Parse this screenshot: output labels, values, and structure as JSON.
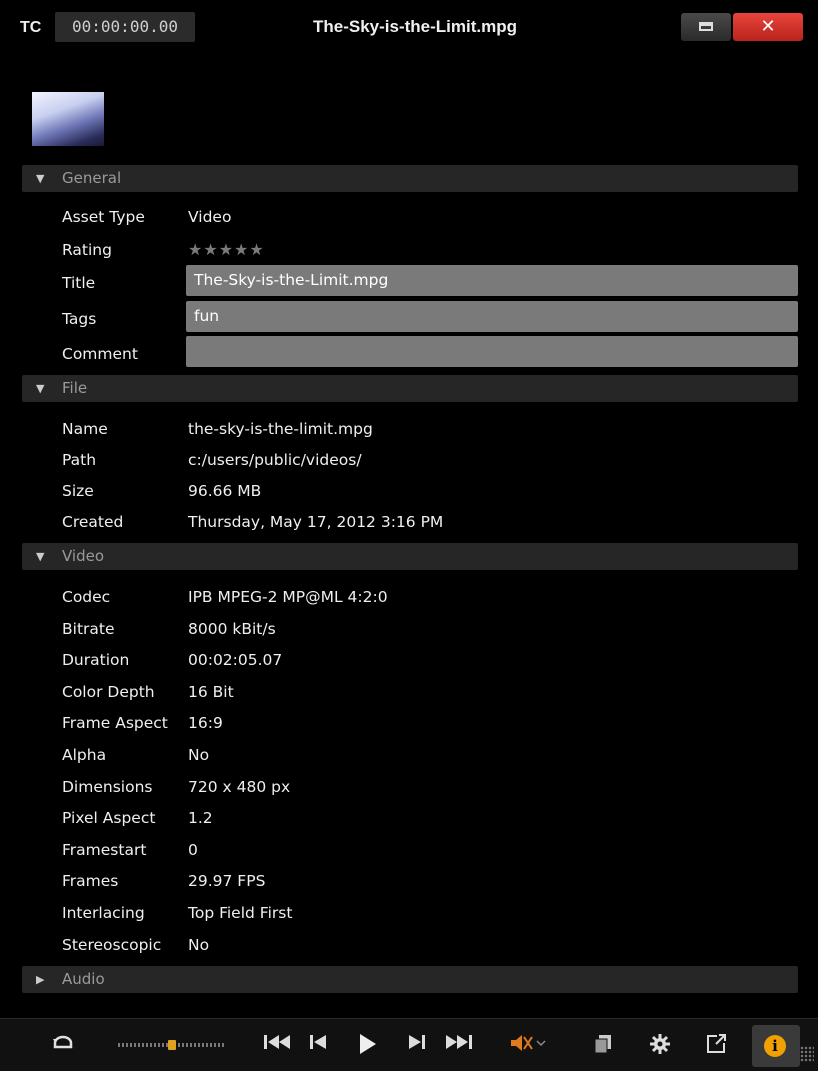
{
  "titlebar": {
    "tc_label": "TC",
    "timecode": "00:00:00.00",
    "title": "The-Sky-is-the-Limit.mpg",
    "close_glyph": "✕"
  },
  "general": {
    "header": "General",
    "asset_type_label": "Asset Type",
    "asset_type": "Video",
    "rating_label": "Rating",
    "rating_stars": 0,
    "rating_glyphs": "★★★★★",
    "title_label": "Title",
    "title_value": "The-Sky-is-the-Limit.mpg",
    "tags_label": "Tags",
    "tags_value": "fun",
    "comment_label": "Comment",
    "comment_value": ""
  },
  "file": {
    "header": "File",
    "name_label": "Name",
    "name": "the-sky-is-the-limit.mpg",
    "path_label": "Path",
    "path": "c:/users/public/videos/",
    "size_label": "Size",
    "size": "96.66 MB",
    "created_label": "Created",
    "created": "Thursday, May 17, 2012 3:16 PM"
  },
  "video": {
    "header": "Video",
    "rows": [
      {
        "label": "Codec",
        "value": "IPB MPEG-2  MP@ML 4:2:0"
      },
      {
        "label": "Bitrate",
        "value": "8000 kBit/s"
      },
      {
        "label": "Duration",
        "value": "00:02:05.07"
      },
      {
        "label": "Color Depth",
        "value": "16 Bit"
      },
      {
        "label": "Frame Aspect",
        "value": "16:9"
      },
      {
        "label": "Alpha",
        "value": "No"
      },
      {
        "label": "Dimensions",
        "value": "720 x 480 px"
      },
      {
        "label": "Pixel Aspect",
        "value": "1.2"
      },
      {
        "label": "Framestart",
        "value": "0"
      },
      {
        "label": "Frames",
        "value": "29.97 FPS"
      },
      {
        "label": "Interlacing",
        "value": "Top Field First"
      },
      {
        "label": "Stereoscopic",
        "value": "No"
      }
    ]
  },
  "audio": {
    "header": "Audio"
  },
  "bottombar": {
    "icons": [
      "loop-icon",
      "shuttle-slider",
      "go-to-start-icon",
      "previous-frame-icon",
      "play-icon",
      "next-frame-icon",
      "go-to-end-icon",
      "mute-icon",
      "copy-icon",
      "settings-icon",
      "external-preview-icon",
      "info-icon"
    ],
    "accent": "#f0a000",
    "shuttle_position": 0.5
  },
  "colors": {
    "background": "#000000",
    "section_header": "#262626",
    "field": "#7a7a7a",
    "close_button": "#d8322a"
  }
}
